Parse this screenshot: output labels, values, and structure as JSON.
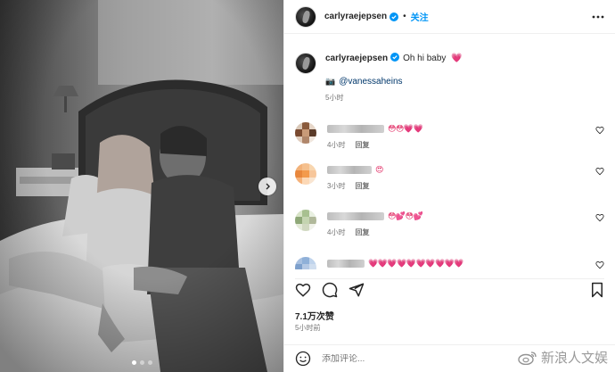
{
  "post": {
    "author": "carlyraejepsen",
    "separator": "•",
    "follow_label": "关注",
    "caption_text": "Oh hi baby",
    "caption_emoji": "💗",
    "mention_icon": "📷",
    "mention": "@vanessaheins",
    "caption_time": "5小时",
    "likes": "7.1万次赞",
    "time_ago": "5小时前",
    "add_comment_placeholder": "添加评论...",
    "photo_index": 1,
    "photo_count": 3
  },
  "comments": [
    {
      "emojis": "😳😳💗💗",
      "time": "4小时",
      "reply_label": "回复"
    },
    {
      "emojis": "😍",
      "time": "3小时",
      "reply_label": "回复"
    },
    {
      "emojis": "😳💕😳💕",
      "time": "4小时",
      "reply_label": "回复"
    },
    {
      "emojis": "💗💗💗💗💗💗💗💗💗💗",
      "time": "",
      "reply_label": ""
    }
  ],
  "watermark": {
    "text": "新浪人文娱"
  },
  "icons": {
    "verified": "verified-badge-icon",
    "more": "more-options-icon",
    "like": "heart-icon",
    "comment": "comment-bubble-icon",
    "share": "paper-plane-icon",
    "save": "bookmark-icon",
    "emoji": "smiley-icon",
    "next": "chevron-right-icon"
  },
  "colors": {
    "accent": "#0095f6",
    "verified": "#0095f6",
    "heart": "#e0245e",
    "text_muted": "#737373"
  }
}
